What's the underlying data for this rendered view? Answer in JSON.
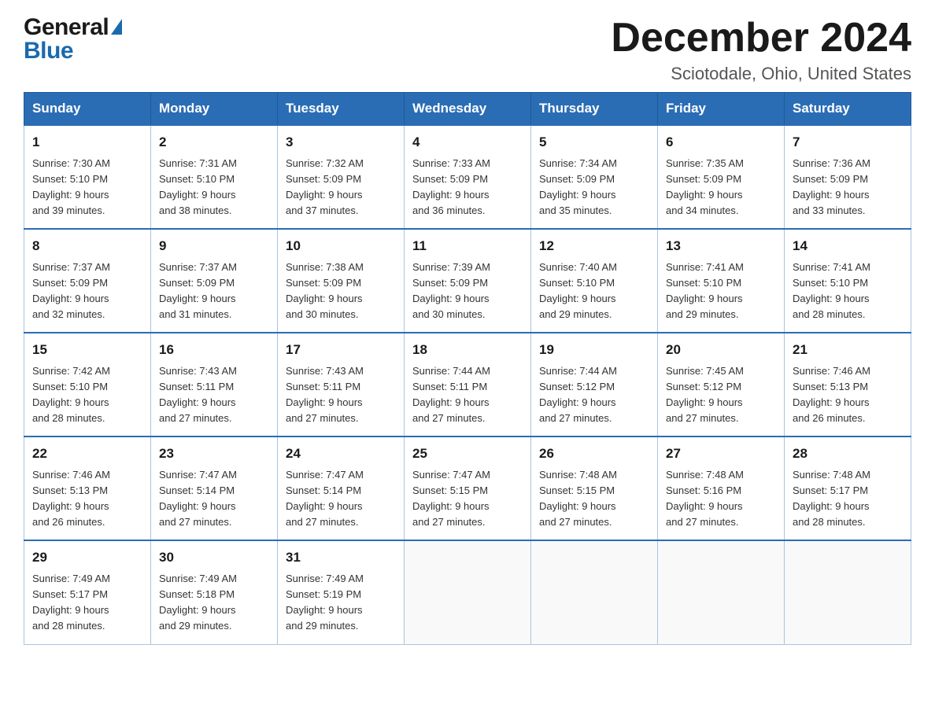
{
  "header": {
    "logo_general": "General",
    "logo_blue": "Blue",
    "month_title": "December 2024",
    "location": "Sciotodale, Ohio, United States"
  },
  "days_of_week": [
    "Sunday",
    "Monday",
    "Tuesday",
    "Wednesday",
    "Thursday",
    "Friday",
    "Saturday"
  ],
  "weeks": [
    [
      {
        "day": "1",
        "sunrise": "7:30 AM",
        "sunset": "5:10 PM",
        "daylight": "9 hours and 39 minutes."
      },
      {
        "day": "2",
        "sunrise": "7:31 AM",
        "sunset": "5:10 PM",
        "daylight": "9 hours and 38 minutes."
      },
      {
        "day": "3",
        "sunrise": "7:32 AM",
        "sunset": "5:09 PM",
        "daylight": "9 hours and 37 minutes."
      },
      {
        "day": "4",
        "sunrise": "7:33 AM",
        "sunset": "5:09 PM",
        "daylight": "9 hours and 36 minutes."
      },
      {
        "day": "5",
        "sunrise": "7:34 AM",
        "sunset": "5:09 PM",
        "daylight": "9 hours and 35 minutes."
      },
      {
        "day": "6",
        "sunrise": "7:35 AM",
        "sunset": "5:09 PM",
        "daylight": "9 hours and 34 minutes."
      },
      {
        "day": "7",
        "sunrise": "7:36 AM",
        "sunset": "5:09 PM",
        "daylight": "9 hours and 33 minutes."
      }
    ],
    [
      {
        "day": "8",
        "sunrise": "7:37 AM",
        "sunset": "5:09 PM",
        "daylight": "9 hours and 32 minutes."
      },
      {
        "day": "9",
        "sunrise": "7:37 AM",
        "sunset": "5:09 PM",
        "daylight": "9 hours and 31 minutes."
      },
      {
        "day": "10",
        "sunrise": "7:38 AM",
        "sunset": "5:09 PM",
        "daylight": "9 hours and 30 minutes."
      },
      {
        "day": "11",
        "sunrise": "7:39 AM",
        "sunset": "5:09 PM",
        "daylight": "9 hours and 30 minutes."
      },
      {
        "day": "12",
        "sunrise": "7:40 AM",
        "sunset": "5:10 PM",
        "daylight": "9 hours and 29 minutes."
      },
      {
        "day": "13",
        "sunrise": "7:41 AM",
        "sunset": "5:10 PM",
        "daylight": "9 hours and 29 minutes."
      },
      {
        "day": "14",
        "sunrise": "7:41 AM",
        "sunset": "5:10 PM",
        "daylight": "9 hours and 28 minutes."
      }
    ],
    [
      {
        "day": "15",
        "sunrise": "7:42 AM",
        "sunset": "5:10 PM",
        "daylight": "9 hours and 28 minutes."
      },
      {
        "day": "16",
        "sunrise": "7:43 AM",
        "sunset": "5:11 PM",
        "daylight": "9 hours and 27 minutes."
      },
      {
        "day": "17",
        "sunrise": "7:43 AM",
        "sunset": "5:11 PM",
        "daylight": "9 hours and 27 minutes."
      },
      {
        "day": "18",
        "sunrise": "7:44 AM",
        "sunset": "5:11 PM",
        "daylight": "9 hours and 27 minutes."
      },
      {
        "day": "19",
        "sunrise": "7:44 AM",
        "sunset": "5:12 PM",
        "daylight": "9 hours and 27 minutes."
      },
      {
        "day": "20",
        "sunrise": "7:45 AM",
        "sunset": "5:12 PM",
        "daylight": "9 hours and 27 minutes."
      },
      {
        "day": "21",
        "sunrise": "7:46 AM",
        "sunset": "5:13 PM",
        "daylight": "9 hours and 26 minutes."
      }
    ],
    [
      {
        "day": "22",
        "sunrise": "7:46 AM",
        "sunset": "5:13 PM",
        "daylight": "9 hours and 26 minutes."
      },
      {
        "day": "23",
        "sunrise": "7:47 AM",
        "sunset": "5:14 PM",
        "daylight": "9 hours and 27 minutes."
      },
      {
        "day": "24",
        "sunrise": "7:47 AM",
        "sunset": "5:14 PM",
        "daylight": "9 hours and 27 minutes."
      },
      {
        "day": "25",
        "sunrise": "7:47 AM",
        "sunset": "5:15 PM",
        "daylight": "9 hours and 27 minutes."
      },
      {
        "day": "26",
        "sunrise": "7:48 AM",
        "sunset": "5:15 PM",
        "daylight": "9 hours and 27 minutes."
      },
      {
        "day": "27",
        "sunrise": "7:48 AM",
        "sunset": "5:16 PM",
        "daylight": "9 hours and 27 minutes."
      },
      {
        "day": "28",
        "sunrise": "7:48 AM",
        "sunset": "5:17 PM",
        "daylight": "9 hours and 28 minutes."
      }
    ],
    [
      {
        "day": "29",
        "sunrise": "7:49 AM",
        "sunset": "5:17 PM",
        "daylight": "9 hours and 28 minutes."
      },
      {
        "day": "30",
        "sunrise": "7:49 AM",
        "sunset": "5:18 PM",
        "daylight": "9 hours and 29 minutes."
      },
      {
        "day": "31",
        "sunrise": "7:49 AM",
        "sunset": "5:19 PM",
        "daylight": "9 hours and 29 minutes."
      },
      null,
      null,
      null,
      null
    ]
  ],
  "labels": {
    "sunrise": "Sunrise:",
    "sunset": "Sunset:",
    "daylight": "Daylight:"
  }
}
